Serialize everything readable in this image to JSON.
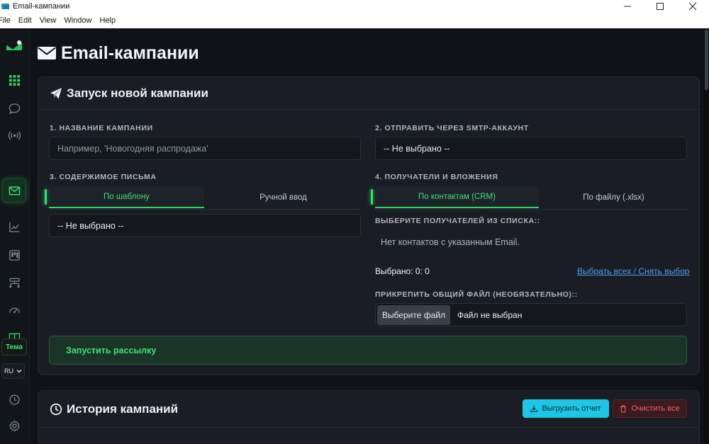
{
  "window": {
    "title": "Email-кампании"
  },
  "menu": [
    "File",
    "Edit",
    "View",
    "Window",
    "Help"
  ],
  "sidebar": {
    "icons": [
      "grid-icon",
      "chat-icon",
      "broadcast-icon",
      "mail-icon",
      "chart-icon",
      "kanban-icon",
      "network-icon",
      "dashboard-icon",
      "book-icon"
    ],
    "theme_label": "Тема",
    "lang_label": "RU",
    "bottom_icons": [
      "clock-icon",
      "gear-icon"
    ],
    "accent": "#2fd66a"
  },
  "page": {
    "title": "Email-кампании"
  },
  "new_campaign": {
    "header": "Запуск новой кампании",
    "name": {
      "label": "1. НАЗВАНИЕ КАМПАНИИ",
      "placeholder": "Например, 'Новогодняя распродажа'"
    },
    "smtp": {
      "label": "2. ОТПРАВИТЬ ЧЕРЕЗ SMTP-АККАУНТ",
      "value": "-- Не выбрано --"
    },
    "content": {
      "label": "3. СОДЕРЖИМОЕ ПИСЬМА",
      "tabs": [
        {
          "label": "По шаблону",
          "active": true
        },
        {
          "label": "Ручной ввод",
          "active": false
        }
      ],
      "template_value": "-- Не выбрано --"
    },
    "recipients": {
      "label": "4. ПОЛУЧАТЕЛИ И ВЛОЖЕНИЯ",
      "tabs": [
        {
          "label": "По контактам (CRM)",
          "active": true
        },
        {
          "label": "По файлу (.xlsx)",
          "active": false
        }
      ],
      "choose_label": "ВЫБЕРИТЕ ПОЛУЧАТЕЛЕЙ ИЗ СПИСКА::",
      "empty_text": "Нет контактов с указанным Email.",
      "selected_text": "Выбрано: 0: 0",
      "select_all_link": "Выбрать всех / Снять выбор",
      "attach_label": "ПРИКРЕПИТЬ ОБЩИЙ ФАЙЛ (НЕОБЯЗАТЕЛЬНО)::",
      "file_button": "Выберите файл",
      "file_status": "Файл не выбран"
    },
    "launch_button": "Запустить рассылку"
  },
  "history": {
    "header": "История кампаний",
    "export_button": "Выгрузить отчет",
    "clear_button": "Очистить все"
  }
}
